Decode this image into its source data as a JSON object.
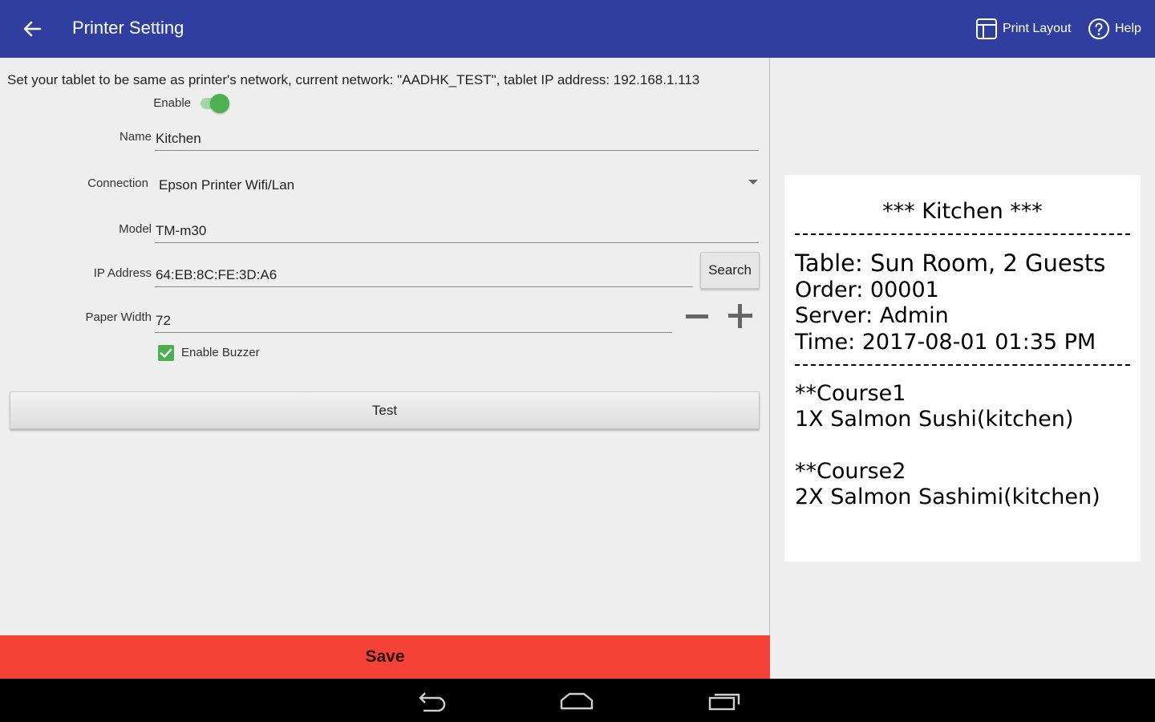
{
  "appbar": {
    "title": "Printer Setting",
    "actions": [
      {
        "label": "Print Layout",
        "icon": "layout-icon"
      },
      {
        "label": "Help",
        "icon": "help-icon"
      }
    ],
    "background": "#303f9f"
  },
  "form": {
    "network_note": "Set your tablet to be same as printer's network, current network: \"AADHK_TEST\", tablet IP address: 192.168.1.113",
    "enable_label": "Enable",
    "enable_on": true,
    "name_label": "Name",
    "name_value": "Kitchen",
    "connection_label": "Connection",
    "connection_value": "Epson Printer Wifi/Lan",
    "model_label": "Model",
    "model_value": "TM-m30",
    "ip_label": "IP Address",
    "ip_value": "64:EB:8C:FE:3D:A6",
    "search_label": "Search",
    "paper_width_label": "Paper Width",
    "paper_width_value": "72",
    "buzzer_label": "Enable Buzzer",
    "buzzer_checked": true,
    "test_label": "Test",
    "save_label": "Save"
  },
  "receipt": {
    "header": "*** Kitchen ***",
    "table": "Table: Sun Room, 2 Guests",
    "order": "Order: 00001",
    "server": "Server: Admin",
    "time": "Time: 2017-08-01 01:35 PM",
    "course1": "**Course1",
    "item1": "1X Salmon Sushi(kitchen)",
    "course2": "**Course2",
    "item2": "2X Salmon Sashimi(kitchen)"
  },
  "colors": {
    "accent_green": "#4caf50",
    "save_red": "#f44336"
  }
}
